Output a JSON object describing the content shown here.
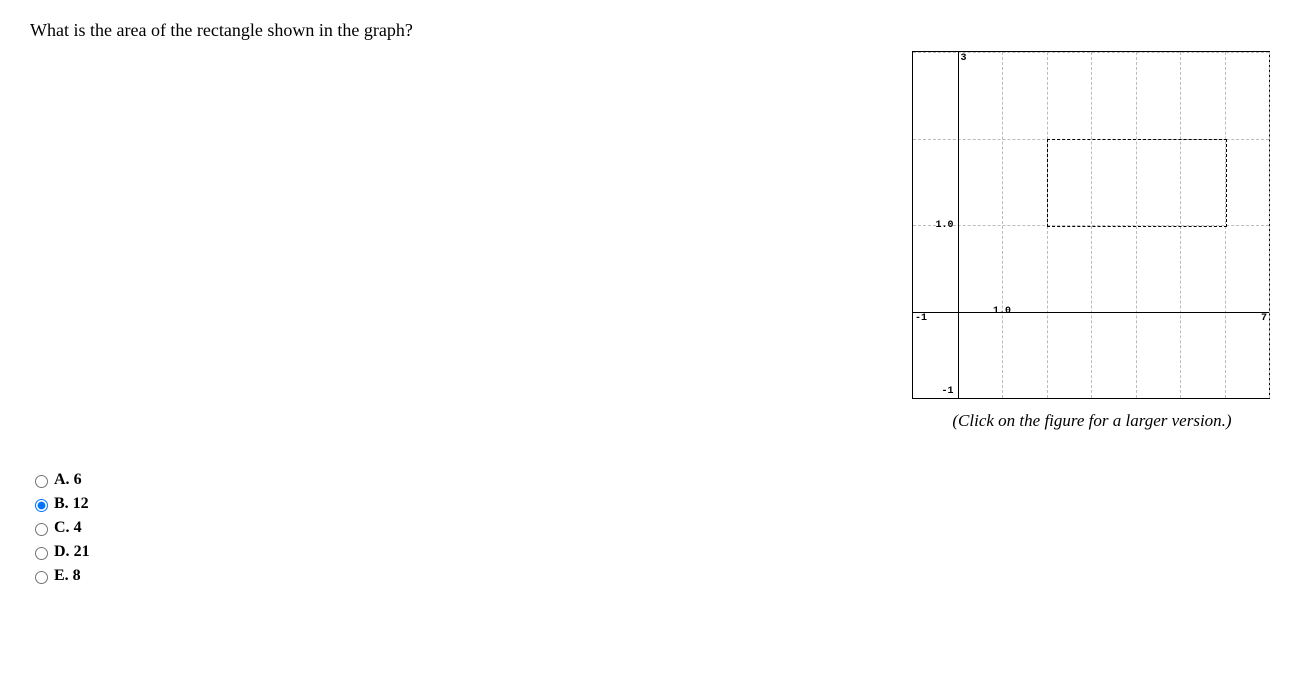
{
  "question": "What is the area of the rectangle shown in the graph?",
  "figure_caption": "(Click on the figure for a larger version.)",
  "options": [
    {
      "letter": "A.",
      "value": "6",
      "selected": false
    },
    {
      "letter": "B.",
      "value": "12",
      "selected": true
    },
    {
      "letter": "C.",
      "value": "4",
      "selected": false
    },
    {
      "letter": "D.",
      "value": "21",
      "selected": false
    },
    {
      "letter": "E.",
      "value": "8",
      "selected": false
    }
  ],
  "chart_data": {
    "type": "scatter",
    "title": "",
    "xlabel": "",
    "ylabel": "",
    "xlim": [
      -1,
      7
    ],
    "ylim": [
      -1,
      3
    ],
    "x_ticks": [
      -1,
      1.0,
      7
    ],
    "y_ticks": [
      -1,
      1.0,
      3
    ],
    "x_tick_labels": [
      "-1",
      "1.0",
      "7"
    ],
    "y_tick_labels": [
      "-1",
      "1.0",
      "3"
    ],
    "grid_x": [
      0,
      1,
      2,
      3,
      4,
      5,
      6,
      7
    ],
    "grid_y": [
      0,
      1,
      2,
      3
    ],
    "rectangle": {
      "x1": 2,
      "y1": 1,
      "x2": 6,
      "y2": 2
    }
  }
}
